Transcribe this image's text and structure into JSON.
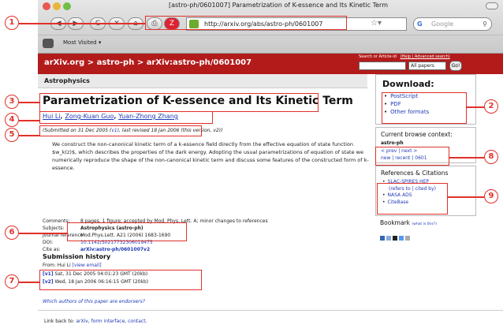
{
  "browser": {
    "window_title": "[astro-ph/0601007] Parametrization of K-essence and Its Kinetic Term",
    "url": "http://arxiv.org/abs/astro-ph/0601007",
    "search_placeholder": "Google",
    "bookmarks_label": "Most Visited ▾",
    "nav_glyphs": {
      "back": "◀",
      "forward": "▶",
      "reload": "C",
      "stop": "✕",
      "home": "⌂",
      "print": "⎙"
    }
  },
  "header": {
    "crumb_site": "arXiv.org",
    "crumb_sep1": " > ",
    "crumb_cat": "astro-ph",
    "crumb_sep2": " > ",
    "crumb_paper": "arXiv:astro-ph/0601007",
    "search_label": "Search or Article-id",
    "help_link": "(Help | Advanced search)",
    "select_value": "All papers",
    "go_label": "Go!"
  },
  "subheader": "Astrophysics",
  "paper": {
    "title": "Parametrization of K-essence and Its Kinetic Term",
    "authors": [
      "Hui Li",
      "Zong-Kuan Guo",
      "Yuan-Zhong Zhang"
    ],
    "author_sep": ", ",
    "submitted_prefix": "(Submitted on 31 Dec 2005 (",
    "submitted_v1": "v1",
    "submitted_suffix": "), last revised 18 Jan 2006 (this version, v2))",
    "abstract": "We construct the non-canonical kinetic term of a k-essence field directly from the effective equation of state function $w_k(z)$, which describes the properties of the dark energy. Adopting the usual parametrizations of equation of state we numerically reproduce the shape of the non-canonical kinetic term and discuss some features of the constructed form of k-essence.",
    "meta": {
      "comments_key": "Comments:",
      "comments": "8 pages, 1 figure; accepted by Mod. Phys. Lett. A; minor changes to references",
      "subjects_key": "Subjects:",
      "subjects": "Astrophysics (astro-ph)",
      "journal_key": "Journal reference:",
      "journal": "Mod.Phys.Lett. A21 (2006) 1683-1690",
      "doi_key": "DOI:",
      "doi": "10.1142/S0217732306019475",
      "cite_key": "Cite as:",
      "cite": "arXiv:astro-ph/0601007v2"
    },
    "history": {
      "heading": "Submission history",
      "from_prefix": "From: Hui Li ",
      "from_link": "[view email]",
      "versions": [
        {
          "tag": "[v1]",
          "text": " Sat, 31 Dec 2005 04:01:23 GMT (20kb)"
        },
        {
          "tag": "[v2]",
          "text": " Wed, 18 Jan 2006 06:16:15 GMT (20kb)"
        }
      ]
    },
    "endorsers": "Which authors of this paper are endorsers?"
  },
  "footer": {
    "prefix": "Link back to: ",
    "links": [
      "arXiv",
      "form interface",
      "contact"
    ],
    "sep": ", ",
    "end": "."
  },
  "sidebar": {
    "download_title": "Download:",
    "download_items": [
      "PostScript",
      "PDF",
      "Other formats"
    ],
    "context_title": "Current browse context:",
    "context_cat": "astro-ph",
    "nav_line1": "< prev | next >",
    "nav_line2": "new | recent | 0601",
    "refs_title": "References & Citations",
    "refs": [
      "SLAC-SPIRES HEP",
      "(refers to | cited by)",
      "NASA ADS",
      "CiteBase"
    ],
    "bookmark_title": "Bookmark",
    "bookmark_what": "(what is this?)"
  },
  "callouts": [
    "1",
    "2",
    "3",
    "4",
    "5",
    "6",
    "7",
    "8",
    "9"
  ],
  "colors": {
    "accent": "#e0312a",
    "arxiv_red": "#b31b1b",
    "link": "#1f3ab6"
  }
}
